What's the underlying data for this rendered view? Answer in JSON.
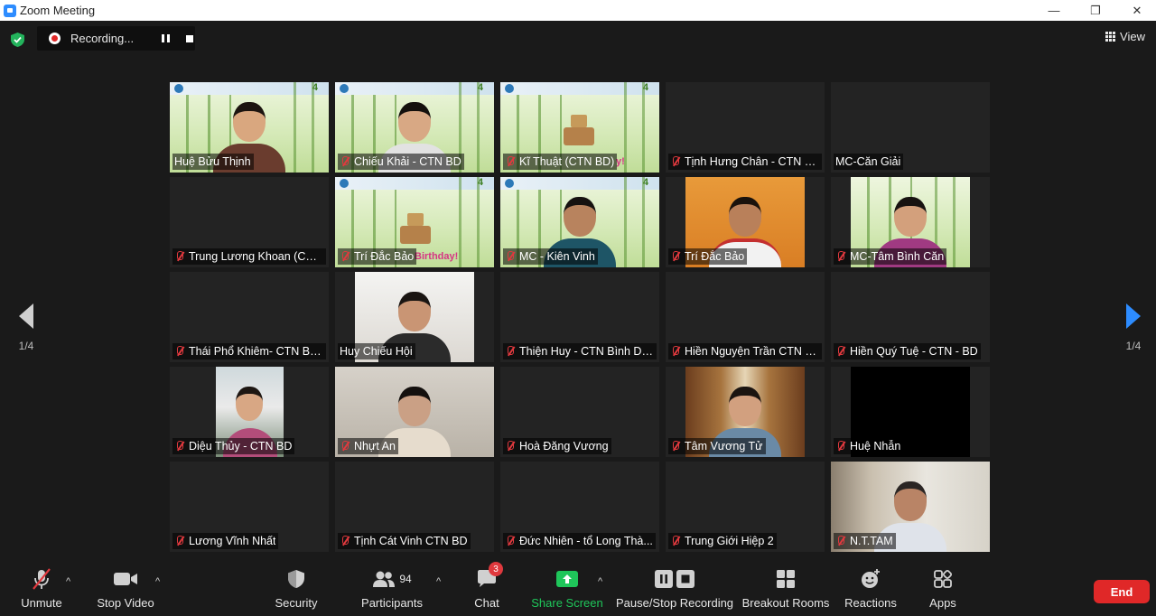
{
  "window": {
    "title": "Zoom Meeting",
    "controls": {
      "minimize": "—",
      "restore": "❐",
      "close": "✕"
    }
  },
  "topbar": {
    "recording_text": "Recording...",
    "view_label": "View"
  },
  "navigation": {
    "prev_page": "1/4",
    "next_page": "1/4"
  },
  "participants_grid": [
    {
      "name": "Huệ Bửu Thịnh",
      "muted": false,
      "video": "bamboo-person",
      "active_speaker": true
    },
    {
      "name": "Chiếu Khải - CTN BD",
      "muted": true,
      "video": "bamboo-person"
    },
    {
      "name": "Kĩ Thuật (CTN BD)",
      "muted": true,
      "video": "bamboo-cake",
      "overlay_text": "y!"
    },
    {
      "name": "Tịnh Hưng Chân - CTN Bì...",
      "muted": true,
      "video": "none"
    },
    {
      "name": "MC-Căn Giải",
      "muted": false,
      "video": "none"
    },
    {
      "name": "Trung Lương Khoan (CTN...",
      "muted": true,
      "video": "none"
    },
    {
      "name": "Trí Đắc Bảo",
      "muted": true,
      "video": "bamboo-cake",
      "overlay_text": "Birthday!"
    },
    {
      "name": "MC - Kiên Vinh",
      "muted": true,
      "video": "bamboo-person"
    },
    {
      "name": "Trí Đắc Bảo",
      "muted": true,
      "video": "camera-orange"
    },
    {
      "name": "MC-Tâm Bình Căn",
      "muted": true,
      "video": "camera-bamboo"
    },
    {
      "name": "Thái Phổ Khiêm- CTN Bìn...",
      "muted": true,
      "video": "none"
    },
    {
      "name": "Huy Chiếu Hội",
      "muted": false,
      "video": "camera-light"
    },
    {
      "name": "Thiện Huy - CTN Bình Dư...",
      "muted": true,
      "video": "none"
    },
    {
      "name": "Hiền Nguyện Trần CTN BD",
      "muted": true,
      "video": "none"
    },
    {
      "name": "Hiền Quý Tuệ - CTN - BD",
      "muted": true,
      "video": "none"
    },
    {
      "name": "Diệu Thủy - CTN BD",
      "muted": true,
      "video": "camera-outdoor"
    },
    {
      "name": "Nhựt An",
      "muted": true,
      "video": "camera-room"
    },
    {
      "name": "Hoà Đăng Vương",
      "muted": true,
      "video": "none"
    },
    {
      "name": "Tâm Vương Tử",
      "muted": true,
      "video": "camera-curtain"
    },
    {
      "name": "Huệ Nhẫn",
      "muted": true,
      "video": "black"
    },
    {
      "name": "Lương Vĩnh Nhất",
      "muted": true,
      "video": "none"
    },
    {
      "name": "Tịnh Cát Vinh CTN BD",
      "muted": true,
      "video": "none"
    },
    {
      "name": "Đức Nhiên - tổ Long Thà...",
      "muted": true,
      "video": "none"
    },
    {
      "name": "Trung Giới Hiệp 2",
      "muted": true,
      "video": "none"
    },
    {
      "name": "N.T.TAM",
      "muted": true,
      "video": "camera-elder"
    }
  ],
  "toolbar": {
    "unmute": "Unmute",
    "stop_video": "Stop Video",
    "security": "Security",
    "participants": "Participants",
    "participants_count": "94",
    "chat": "Chat",
    "chat_badge": "3",
    "share_screen": "Share Screen",
    "pause_stop_recording": "Pause/Stop Recording",
    "breakout_rooms": "Breakout Rooms",
    "reactions": "Reactions",
    "apps": "Apps",
    "end": "End"
  },
  "colors": {
    "active_border": "#d7e34a",
    "share_green": "#1fc65a",
    "end_red": "#e02828",
    "muted_red": "#e0393e",
    "nav_arrow_active": "#2d8cff"
  }
}
